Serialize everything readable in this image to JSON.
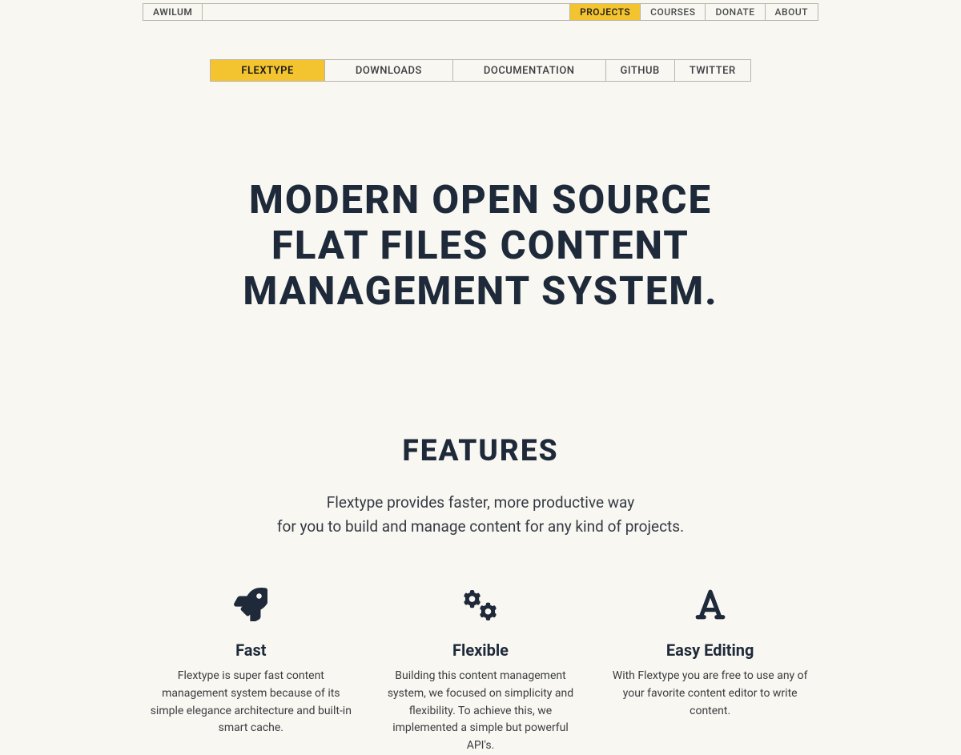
{
  "topnav": {
    "brand": "AWILUM",
    "items": [
      {
        "label": "PROJECTS",
        "active": true
      },
      {
        "label": "COURSES",
        "active": false
      },
      {
        "label": "DONATE",
        "active": false
      },
      {
        "label": "ABOUT",
        "active": false
      }
    ]
  },
  "subnav": {
    "tabs": [
      {
        "label": "FLEXTYPE",
        "active": true
      },
      {
        "label": "DOWNLOADS",
        "active": false
      },
      {
        "label": "DOCUMENTATION",
        "active": false
      },
      {
        "label": "GITHUB",
        "active": false,
        "narrow": true
      },
      {
        "label": "TWITTER",
        "active": false,
        "narrow": true
      }
    ]
  },
  "hero": {
    "line1": "MODERN OPEN SOURCE",
    "line2": "FLAT FILES CONTENT",
    "line3": "MANAGEMENT SYSTEM."
  },
  "features": {
    "title": "FEATURES",
    "sub_line1": "Flextype provides faster, more productive way",
    "sub_line2": "for you to build and manage content for any kind of projects.",
    "items": [
      {
        "icon": "rocket-icon",
        "title": "Fast",
        "desc": "Flextype is super fast content management system because of its simple elegance architecture and built-in smart cache."
      },
      {
        "icon": "gears-icon",
        "title": "Flexible",
        "desc": "Building this content management system, we focused on simplicity and flexibility. To achieve this, we implemented a simple but powerful API's."
      },
      {
        "icon": "font-icon",
        "title": "Easy Editing",
        "desc": "With Flextype you are free to use any of your favorite content editor to write content."
      }
    ]
  }
}
